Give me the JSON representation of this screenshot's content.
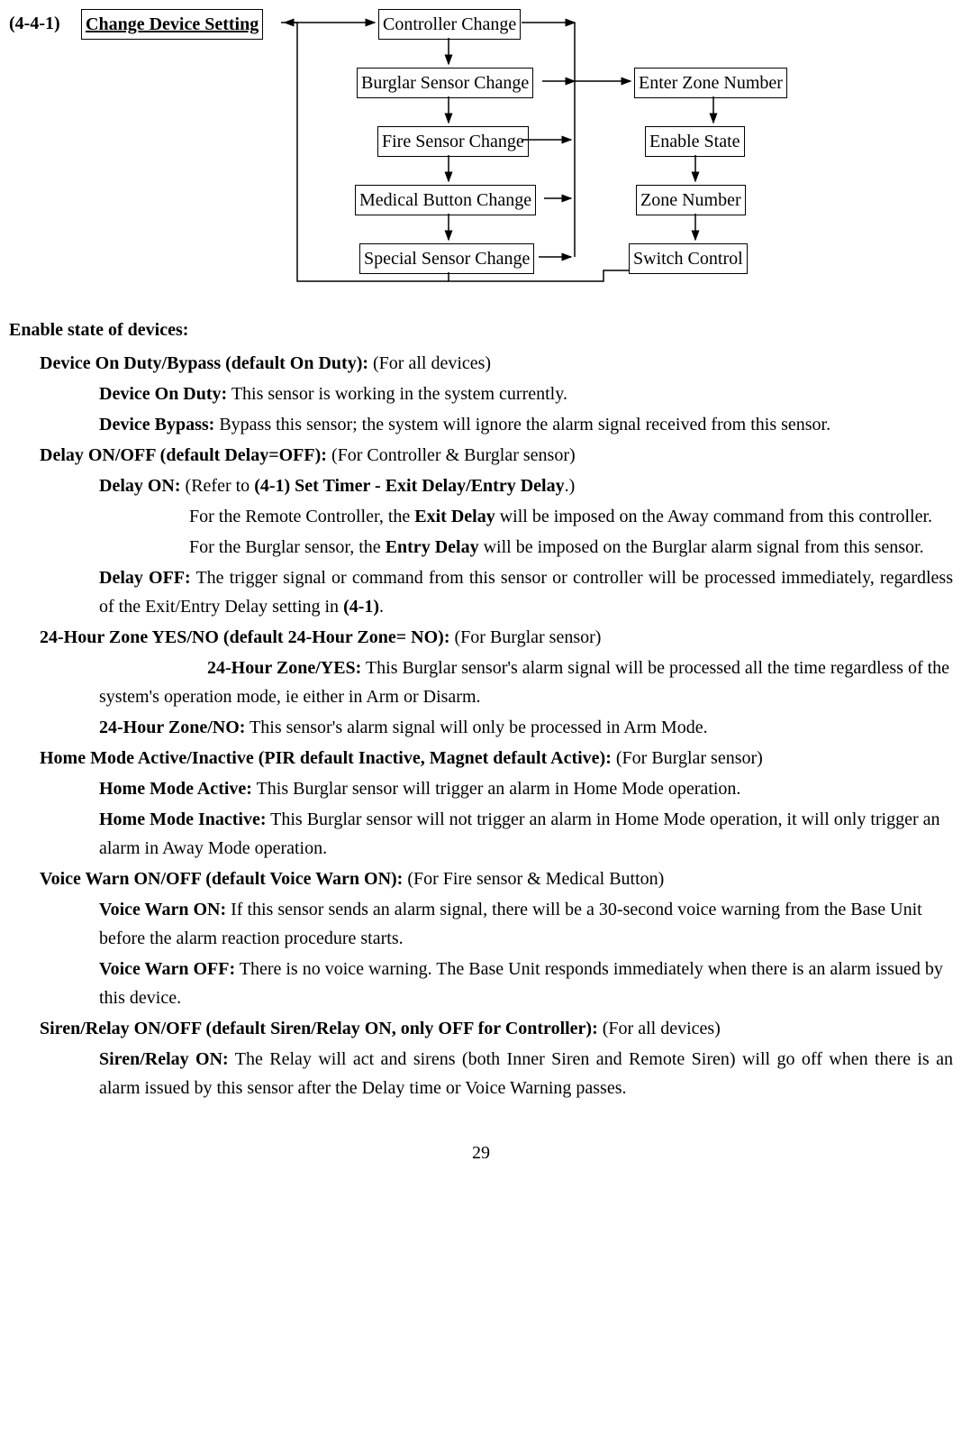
{
  "diagram": {
    "section_label": "(4-4-1)",
    "root": "Change Device Setting",
    "left_col": [
      "Controller Change",
      "Burglar Sensor Change",
      "Fire Sensor Change",
      "Medical Button Change",
      "Special Sensor Change"
    ],
    "right_col": [
      "Enter Zone Number",
      "Enable State",
      "Zone Number",
      "Switch Control"
    ]
  },
  "heading": "Enable state of devices:",
  "body": {
    "item1_title": "Device On Duty/Bypass (default On Duty):",
    "item1_for": " (For all devices)",
    "item1a_label": "Device On Duty:",
    "item1a_text": " This sensor is working in the system currently.",
    "item1b_label": "Device Bypass:",
    "item1b_text": " Bypass this sensor; the system will ignore the alarm signal received from this sensor.",
    "item2_title": "Delay ON/OFF (default Delay=OFF):",
    "item2_for": " (For Controller & Burglar sensor)",
    "item2a_label": "Delay ON:",
    "item2a_text1": " (Refer to ",
    "item2a_bold": "(4-1) Set Timer - Exit Delay/Entry Delay",
    "item2a_text2": ".)",
    "item2a_para2_pre": "For the Remote Controller, the ",
    "item2a_para2_bold": "Exit Delay",
    "item2a_para2_post": " will be imposed on the Away command from this controller.",
    "item2a_para3_pre": "For the Burglar sensor, the ",
    "item2a_para3_bold": "Entry Delay",
    "item2a_para3_post": " will be imposed on the Burglar alarm signal from this sensor.",
    "item2b_label": "Delay OFF:",
    "item2b_text1": " The trigger signal or command from this sensor or controller will be processed immediately, regardless of the Exit/Entry Delay setting in ",
    "item2b_bold": "(4-1)",
    "item2b_text2": ".",
    "item3_title": "24-Hour Zone YES/NO (default 24-Hour Zone= NO):",
    "item3_for": " (For Burglar sensor)",
    "item3a_label": "24-Hour Zone/YES:",
    "item3a_text": " This Burglar sensor's alarm signal will be processed all the time regardless of the system's operation mode, ie either in Arm or Disarm.",
    "item3b_label": "24-Hour Zone/NO:",
    "item3b_text": " This sensor's alarm signal will only be processed in Arm Mode.",
    "item4_title": "Home Mode Active/Inactive (PIR default Inactive, Magnet default Active):",
    "item4_for": " (For Burglar sensor)",
    "item4a_label": "Home Mode Active:",
    "item4a_text": " This Burglar sensor will trigger an alarm in Home Mode operation.",
    "item4b_label": "Home Mode Inactive:",
    "item4b_text": " This Burglar sensor will not trigger an alarm in Home Mode operation, it will only trigger an alarm in Away Mode operation.",
    "item5_title": "Voice Warn ON/OFF (default Voice Warn ON):",
    "item5_for": " (For Fire sensor & Medical Button)",
    "item5a_label": "Voice Warn ON:",
    "item5a_text": " If this sensor sends an alarm signal, there will be a 30-second voice warning from the Base Unit before the alarm reaction procedure starts.",
    "item5b_label": "Voice Warn OFF:",
    "item5b_text": " There is no voice warning. The Base Unit responds immediately when there is an alarm issued by this device.",
    "item6_title": "Siren/Relay ON/OFF (default Siren/Relay ON, only OFF for Controller):",
    "item6_for": " (For all devices)",
    "item6a_label": "Siren/Relay ON:",
    "item6a_text": " The Relay will act and sirens (both Inner Siren and Remote Siren) will go off when there is an alarm issued by this sensor after the Delay time or Voice Warning passes."
  },
  "page_number": "29"
}
